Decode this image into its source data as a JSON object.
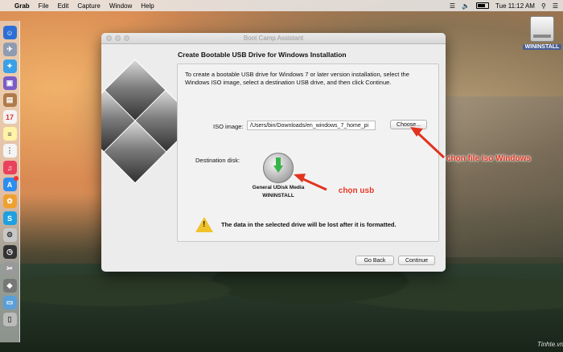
{
  "menubar": {
    "app": "Grab",
    "items": [
      "File",
      "Edit",
      "Capture",
      "Window",
      "Help"
    ],
    "clock": "Tue 11:12 AM"
  },
  "desktop": {
    "drive_label": "WININSTALL",
    "watermark": "Tinhte.vn"
  },
  "window": {
    "title": "Boot Camp Assistant",
    "heading": "Create Bootable USB Drive for Windows Installation",
    "description": "To create a bootable USB drive for Windows 7 or later version installation, select the Windows ISO image, select a destination USB drive, and then click Continue.",
    "iso_label": "ISO image:",
    "iso_path": "/Users/bin/Downloads/en_windows_7_home_pi",
    "choose_label": "Choose...",
    "destination_label": "Destination disk:",
    "usb_name_line1": "General UDisk Media",
    "usb_name_line2": "WININSTALL",
    "warning": "The data in the selected drive will be lost after it is formatted.",
    "back_label": "Go Back",
    "continue_label": "Continue"
  },
  "annotations": {
    "iso": "chọn file iso Windows",
    "usb": "chọn usb"
  },
  "colors": {
    "annotation": "#e2331f",
    "warning": "#f0c22a"
  }
}
